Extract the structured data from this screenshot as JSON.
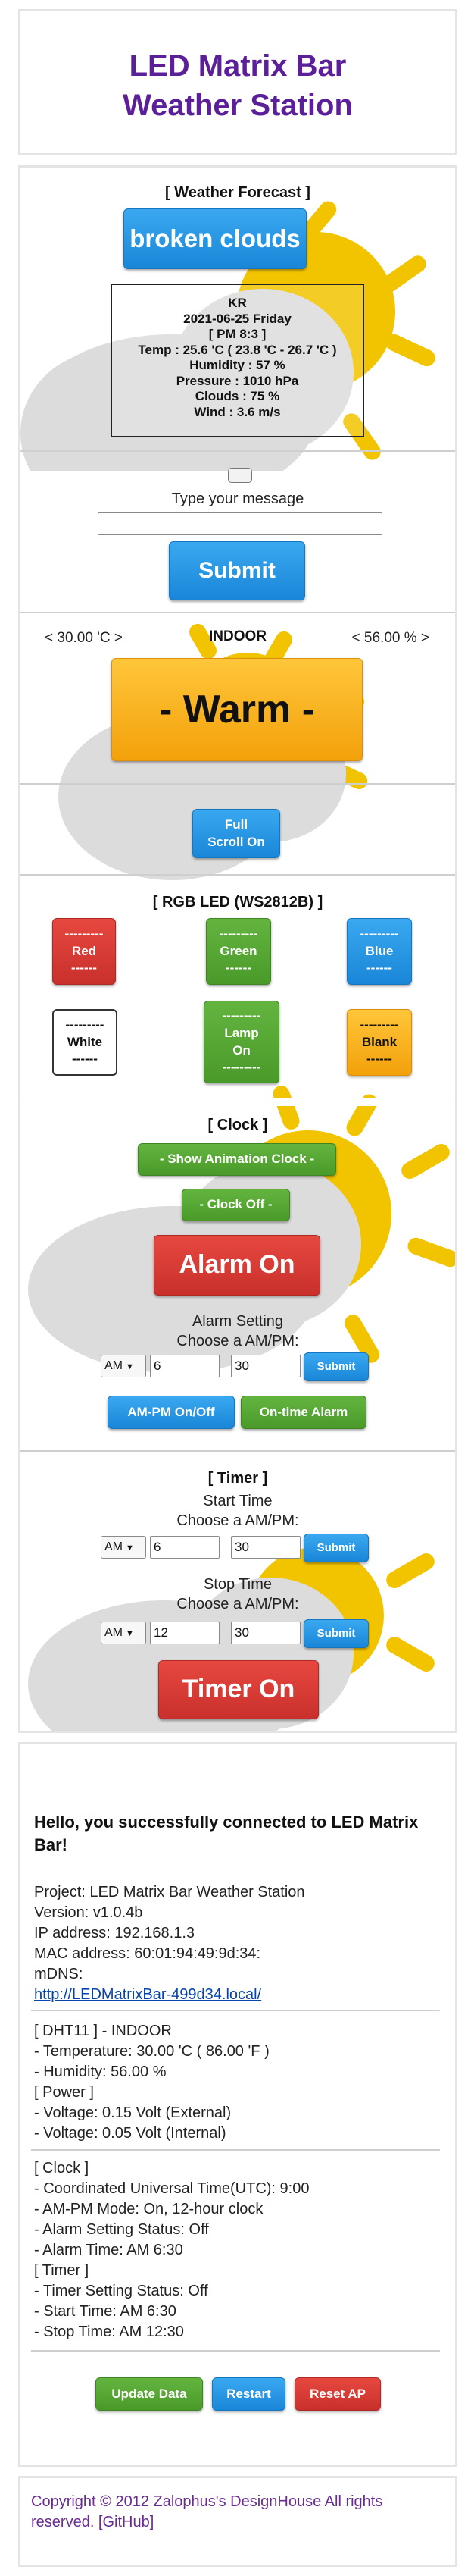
{
  "header": {
    "title_line1": "LED Matrix Bar",
    "title_line2": "Weather Station"
  },
  "forecast": {
    "heading": "[ Weather Forecast ]",
    "condition_button": "broken clouds",
    "lines": [
      "KR",
      "2021-06-25 Friday",
      "[ PM 8:3 ]",
      "Temp : 25.6 'C ( 23.8 'C - 26.7 'C )",
      "Humidity : 57 %",
      "Pressure : 1010 hPa",
      "Clouds : 75 %",
      "Wind : 3.6 m/s"
    ]
  },
  "message": {
    "prompt": "Type your message",
    "placeholder": "",
    "submit_label": "Submit"
  },
  "indoor": {
    "temp_text": "< 30.00 'C >",
    "label": "INDOOR",
    "humidity_text": "< 56.00 % >",
    "status_button": "- Warm -"
  },
  "scroll": {
    "button": "Full\nScroll On"
  },
  "rgb": {
    "heading": "[ RGB LED (WS2812B) ]",
    "buttons": [
      {
        "label": "---------\nRed\n------"
      },
      {
        "label": "---------\nGreen\n------"
      },
      {
        "label": "---------\nBlue\n------"
      },
      {
        "label": "---------\nWhite\n------"
      },
      {
        "label": "---------\nLamp\nOn\n---------"
      },
      {
        "label": "---------\nBlank\n------"
      }
    ]
  },
  "clock": {
    "heading": "[ Clock ]",
    "animation_button": "- Show Animation Clock -",
    "clock_off_button": "- Clock Off -",
    "alarm_button": "Alarm On",
    "alarm_setting": "Alarm Setting",
    "choose_ampm": "Choose a AM/PM:",
    "ampm_value": "AM",
    "hour_value": "6",
    "minute_value": "30",
    "submit_label": "Submit",
    "ampm_toggle": "AM-PM On/Off",
    "ontime_alarm": "On-time Alarm"
  },
  "timer": {
    "heading": "[ Timer ]",
    "start_label": "Start Time",
    "stop_label": "Stop Time",
    "choose_ampm": "Choose a AM/PM:",
    "start": {
      "ampm": "AM",
      "hour": "6",
      "minute": "30"
    },
    "stop": {
      "ampm": "AM",
      "hour": "12",
      "minute": "30"
    },
    "submit_label": "Submit",
    "timer_button": "Timer On"
  },
  "info": {
    "greeting": "Hello, you successfully connected to LED Matrix Bar!",
    "project": "Project: LED Matrix Bar Weather Station",
    "version": "Version: v1.0.4b",
    "ip": "IP address: 192.168.1.3",
    "mac": "MAC address: 60:01:94:49:9d:34:",
    "mdns_label": "mDNS:",
    "mdns_link": "http://LEDMatrixBar-499d34.local/",
    "sensor_lines": [
      "[ DHT11 ] - INDOOR",
      "- Temperature: 30.00 'C ( 86.00 'F )",
      "- Humidity: 56.00 %",
      "[ Power ]",
      "- Voltage: 0.15 Volt (External)",
      "- Voltage: 0.05 Volt (Internal)"
    ],
    "clock_lines": [
      "[ Clock ]",
      "- Coordinated Universal Time(UTC): 9:00",
      "- AM-PM Mode: On, 12-hour clock",
      "- Alarm Setting Status: Off",
      "- Alarm Time: AM 6:30",
      "[ Timer ]",
      "- Timer Setting Status: Off",
      "- Start Time: AM 6:30",
      "- Stop Time: AM 12:30"
    ],
    "update_button": "Update Data",
    "restart_button": "Restart",
    "reset_button": "Reset AP"
  },
  "footer": {
    "text": "Copyright © 2012 Zalophus's DesignHouse All rights reserved. [GitHub]"
  },
  "colors": {
    "title": "#5b1f9a",
    "sun": "#f2c400",
    "cloud": "#dcdcdc",
    "footer": "#6a2c91",
    "link": "#0645ad"
  }
}
